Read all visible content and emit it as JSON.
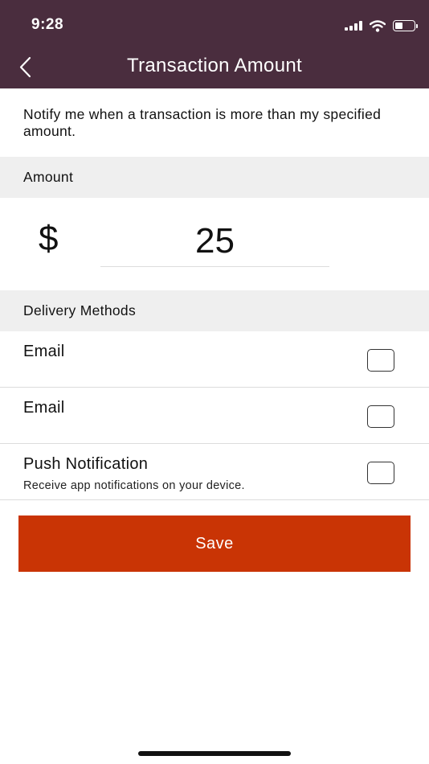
{
  "status_bar": {
    "time": "9:28"
  },
  "nav": {
    "title": "Transaction Amount"
  },
  "intro": {
    "text": "Notify me when a transaction is more than my specified amount."
  },
  "amount": {
    "section_label": "Amount",
    "currency_symbol": "$",
    "value": "25"
  },
  "delivery": {
    "section_label": "Delivery Methods",
    "methods": [
      {
        "label": "Email",
        "checked": false
      },
      {
        "label": "Email",
        "checked": false
      },
      {
        "label": "Push Notification",
        "description": "Receive app notifications on your device.",
        "checked": false
      }
    ]
  },
  "actions": {
    "save_label": "Save"
  },
  "colors": {
    "header_bg": "#4a2d3e",
    "save_bg": "#c93405",
    "section_bg": "#efefef"
  },
  "icons": [
    "back-chevron-icon",
    "cellular-signal-icon",
    "wifi-icon",
    "battery-icon"
  ]
}
